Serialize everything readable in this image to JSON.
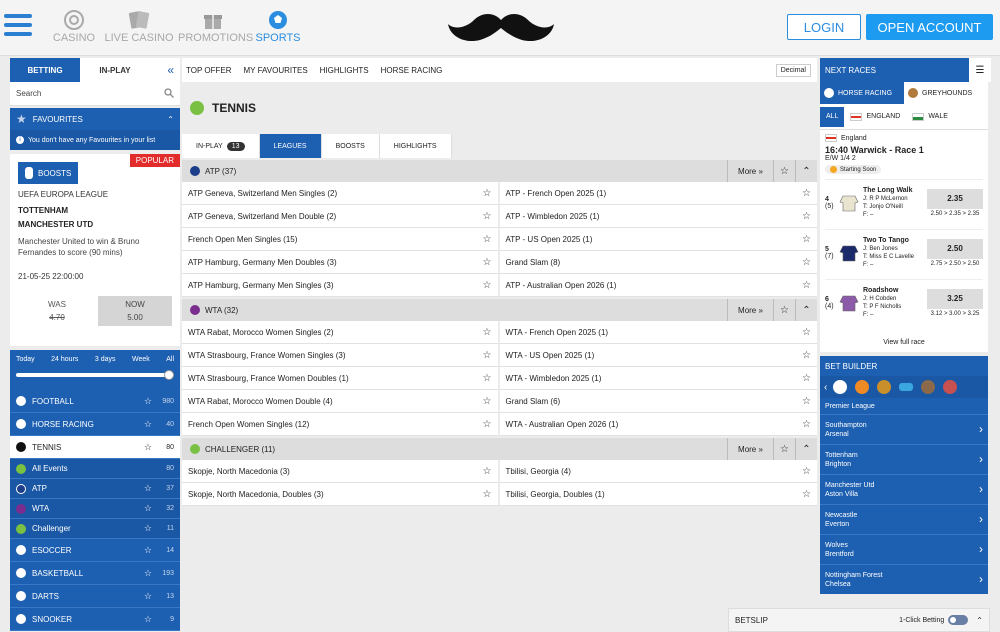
{
  "header": {
    "nav": [
      {
        "label": "CASINO",
        "icon": "casino-chip-icon"
      },
      {
        "label": "LIVE CASINO",
        "icon": "cards-icon"
      },
      {
        "label": "PROMOTIONS",
        "icon": "gift-icon"
      },
      {
        "label": "SPORTS",
        "icon": "football-icon",
        "active": true
      }
    ],
    "login": "LOGIN",
    "open_account": "OPEN ACCOUNT"
  },
  "left": {
    "tab_betting": "BETTING",
    "tab_inplay": "IN-PLAY",
    "search_placeholder": "Search",
    "favourites": "FAVOURITES",
    "fav_msg": "You don't have any Favourites in your list",
    "promo": {
      "popular": "POPULAR",
      "tag": "BOOSTS",
      "league": "UEFA EUROPA LEAGUE",
      "team1": "TOTTENHAM",
      "team2": "MANCHESTER UTD",
      "desc": "Manchester United to win & Bruno Fernandes to score (90 mins)",
      "date": "21-05-25 22:00:00",
      "was_label": "WAS",
      "was_value": "4.70",
      "now_label": "NOW",
      "now_value": "5.00"
    },
    "time_opts": [
      "Today",
      "24 hours",
      "3 days",
      "Week",
      "All"
    ],
    "sports": [
      {
        "name": "FOOTBALL",
        "count": "980"
      },
      {
        "name": "HORSE RACING",
        "count": "40"
      },
      {
        "name": "TENNIS",
        "count": "80",
        "active": true
      }
    ],
    "tennis_subs": [
      {
        "name": "All Events",
        "count": "80"
      },
      {
        "name": "ATP",
        "count": "37"
      },
      {
        "name": "WTA",
        "count": "32"
      },
      {
        "name": "Challenger",
        "count": "11"
      }
    ],
    "sports2": [
      {
        "name": "ESOCCER",
        "count": "14"
      },
      {
        "name": "BASKETBALL",
        "count": "193"
      },
      {
        "name": "DARTS",
        "count": "13"
      },
      {
        "name": "SNOOKER",
        "count": "9"
      }
    ]
  },
  "center": {
    "nav": [
      "TOP OFFER",
      "MY FAVOURITES",
      "HIGHLIGHTS",
      "HORSE RACING"
    ],
    "odds_format": "Decimal",
    "title": "TENNIS",
    "tabs": {
      "inplay": "IN-PLAY",
      "inplay_count": "13",
      "leagues": "LEAGUES",
      "boosts": "BOOSTS",
      "highlights": "HIGHLIGHTS"
    },
    "more": "More",
    "groups": [
      {
        "name": "ATP (37)",
        "color": "#1d3e8a",
        "rows": [
          "ATP Geneva, Switzerland Men Singles  (2)",
          "ATP - French Open 2025  (1)",
          "ATP Geneva, Switzerland Men Double  (2)",
          "ATP - Wimbledon 2025  (1)",
          "French Open Men Singles  (15)",
          "ATP - US Open 2025  (1)",
          "ATP Hamburg, Germany Men Doubles  (3)",
          "Grand Slam  (8)",
          "ATP Hamburg, Germany Men Singles  (3)",
          "ATP - Australian Open 2026  (1)"
        ]
      },
      {
        "name": "WTA (32)",
        "color": "#7a2d8f",
        "rows": [
          "WTA Rabat, Morocco Women Singles  (2)",
          "WTA - French Open 2025  (1)",
          "WTA Strasbourg, France Women Singles  (3)",
          "WTA - US Open 2025  (1)",
          "WTA Strasbourg, France Women Doubles  (1)",
          "WTA - Wimbledon 2025  (1)",
          "WTA Rabat, Morocco Women Double  (4)",
          "Grand Slam  (6)",
          "French Open Women Singles  (12)",
          "WTA - Australian Open 2026  (1)"
        ]
      },
      {
        "name": "CHALLENGER (11)",
        "color": "#7ac143",
        "rows": [
          "Skopje, North Macedonia  (3)",
          "Tbilisi, Georgia  (4)",
          "Skopje, North Macedonia, Doubles  (3)",
          "Tbilisi, Georgia, Doubles  (1)"
        ]
      }
    ]
  },
  "right": {
    "next_races": "NEXT RACES",
    "horse_racing": "HORSE RACING",
    "greyhounds": "GREYHOUNDS",
    "countries": [
      "ALL",
      "ENGLAND",
      "WALE"
    ],
    "race": {
      "country": "England",
      "title": "16:40 Warwick - Race 1",
      "ew": "E/W 1/4 2",
      "status": "Starting Soon",
      "runners": [
        {
          "num": "4",
          "draw": "(5)",
          "name": "The Long Walk",
          "j": "J: R P McLernon",
          "t": "T: Jonjo O'Neill",
          "f": "F: –",
          "odds": "2.35",
          "hist": "2.50 > 2.35 > 2.35",
          "silk": "#e8e4d0"
        },
        {
          "num": "5",
          "draw": "(7)",
          "name": "Two To Tango",
          "j": "J: Ben Jones",
          "t": "T: Miss E C Lavelle",
          "f": "F: –",
          "odds": "2.50",
          "hist": "2.75 > 2.50 > 2.50",
          "silk": "#1b2a6b"
        },
        {
          "num": "6",
          "draw": "(4)",
          "name": "Roadshow",
          "j": "J: H Cobden",
          "t": "T: P F Nicholls",
          "f": "F: –",
          "odds": "3.25",
          "hist": "3.12 > 3.00 > 3.25",
          "silk": "#8b5aa8"
        }
      ],
      "view_full": "View full race"
    },
    "bet_builder": "BET BUILDER",
    "bb_league": "Premier League",
    "matches": [
      [
        "Southampton",
        "Arsenal"
      ],
      [
        "Tottenham",
        "Brighton"
      ],
      [
        "Manchester Utd",
        "Aston Villa"
      ],
      [
        "Newcastle",
        "Everton"
      ],
      [
        "Wolves",
        "Brentford"
      ],
      [
        "Nottingham Forest",
        "Chelsea"
      ]
    ]
  },
  "betslip": {
    "label": "BETSLIP",
    "one_click": "1-Click Betting"
  }
}
